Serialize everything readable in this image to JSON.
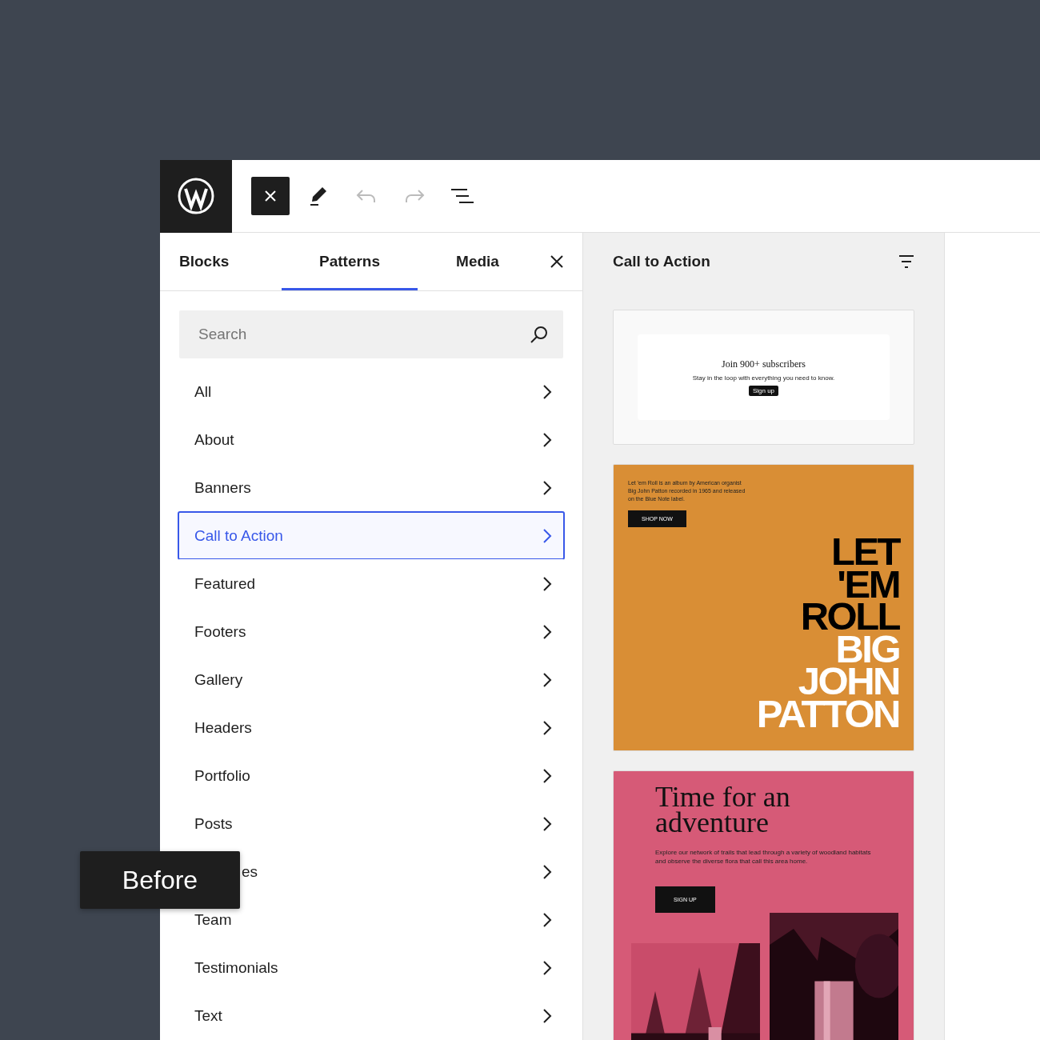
{
  "toolbar": {
    "buttons": [
      {
        "kind": "close",
        "pressed": true,
        "disabled": false
      },
      {
        "kind": "edit",
        "pressed": false,
        "disabled": false
      },
      {
        "kind": "undo",
        "pressed": false,
        "disabled": true
      },
      {
        "kind": "redo",
        "pressed": false,
        "disabled": true
      },
      {
        "kind": "outline",
        "pressed": false,
        "disabled": false
      }
    ]
  },
  "tabs": [
    {
      "label": "Blocks",
      "selected": false
    },
    {
      "label": "Patterns",
      "selected": true
    },
    {
      "label": "Media",
      "selected": false
    }
  ],
  "search": {
    "placeholder": "Search"
  },
  "categories": [
    {
      "label": "All",
      "selected": false,
      "clipped": false
    },
    {
      "label": "About",
      "selected": false,
      "clipped": false
    },
    {
      "label": "Banners",
      "selected": false,
      "clipped": false
    },
    {
      "label": "Call to Action",
      "selected": true,
      "clipped": false
    },
    {
      "label": "Featured",
      "selected": false,
      "clipped": false
    },
    {
      "label": "Footers",
      "selected": false,
      "clipped": false
    },
    {
      "label": "Gallery",
      "selected": false,
      "clipped": false
    },
    {
      "label": "Headers",
      "selected": false,
      "clipped": false
    },
    {
      "label": "Portfolio",
      "selected": false,
      "clipped": false
    },
    {
      "label": "Posts",
      "selected": false,
      "clipped": false
    },
    {
      "label": "es",
      "selected": false,
      "clipped": true
    },
    {
      "label": "Team",
      "selected": false,
      "clipped": false
    },
    {
      "label": "Testimonials",
      "selected": false,
      "clipped": false
    },
    {
      "label": "Text",
      "selected": false,
      "clipped": false
    }
  ],
  "badge": {
    "label": "Before"
  },
  "preview": {
    "title": "Call to Action",
    "patterns": [
      {
        "kind": "subscribe",
        "heading": "Join 900+ subscribers",
        "text": "Stay in the loop with everything you need to know.",
        "button": "Sign up"
      },
      {
        "kind": "album",
        "text": "Let 'em Roll is an album by American organist Big John Patton recorded in 1965 and released on the Blue Note label.",
        "button": "SHOP NOW",
        "lines": [
          {
            "text": "LET",
            "color": "#000000"
          },
          {
            "text": "'EM",
            "color": "#000000"
          },
          {
            "text": "ROLL",
            "color": "#000000"
          },
          {
            "text": "BIG",
            "color": "#ffffff"
          },
          {
            "text": "JOHN",
            "color": "#ffffff"
          },
          {
            "text": "PATTON",
            "color": "#ffffff"
          }
        ]
      },
      {
        "kind": "adventure",
        "heading": "Time for an adventure",
        "text": "Explore our network of trails that lead through a variety of woodland habitats and observe the diverse flora that call this area home.",
        "button": "SIGN UP"
      }
    ]
  }
}
